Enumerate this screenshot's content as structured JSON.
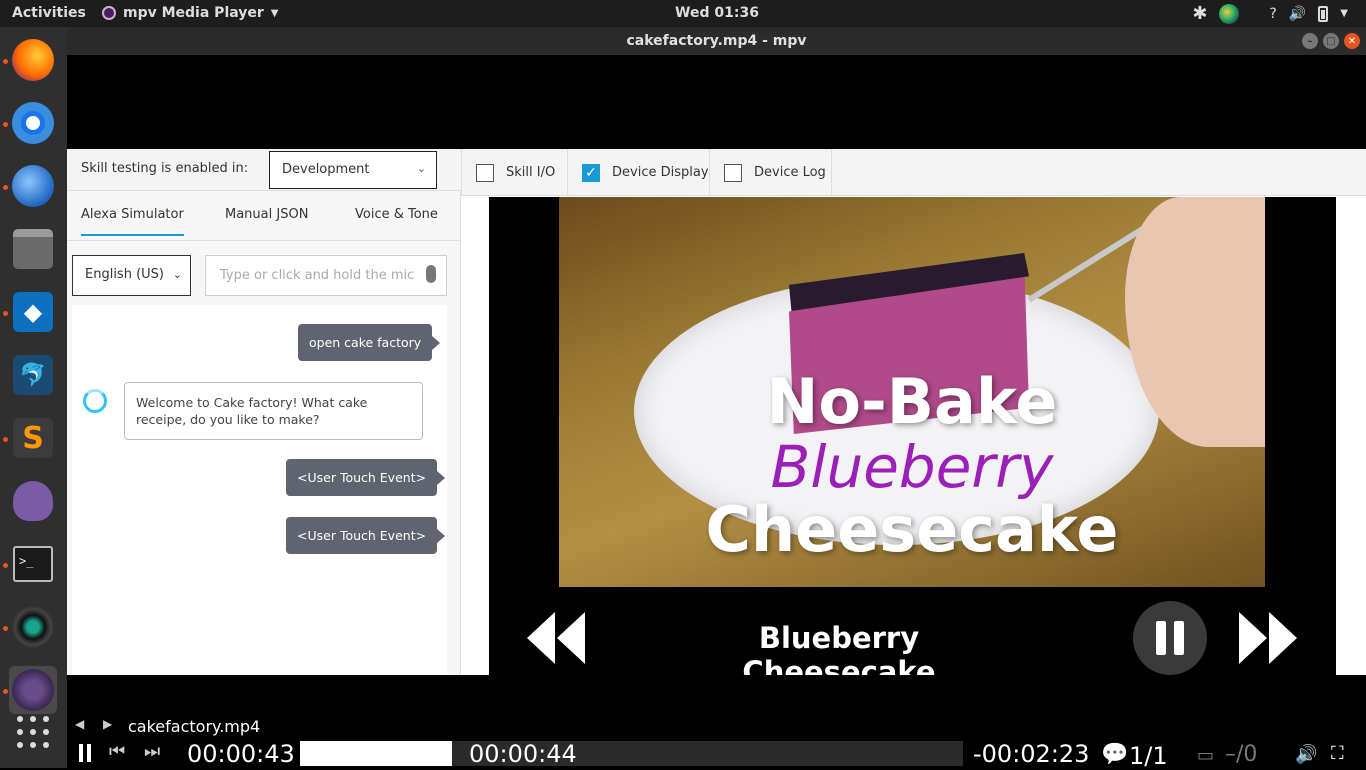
{
  "topbar": {
    "activities": "Activities",
    "app_name": "mpv Media Player",
    "clock": "Wed 01:36",
    "tray_help": "?"
  },
  "dock": {
    "apps": [
      "firefox-icon",
      "chromium-icon",
      "thunderbird-icon",
      "files-icon",
      "vscode-icon",
      "mysql-workbench-icon",
      "sublime-text-icon",
      "pidgin-icon",
      "terminal-icon",
      "camera-icon",
      "mpv-icon"
    ],
    "terminal_glyph": ">_",
    "vscode_glyph": "◆",
    "sublime_glyph": "S",
    "workbench_glyph": "🐬"
  },
  "window": {
    "title": "cakefactory.mp4 - mpv"
  },
  "console": {
    "skill_label": "Skill testing is enabled in:",
    "stage_value": "Development",
    "checkboxes": [
      {
        "label": "Skill I/O",
        "checked": false
      },
      {
        "label": "Device Display",
        "checked": true
      },
      {
        "label": "Device Log",
        "checked": false
      }
    ],
    "tabs": [
      "Alexa Simulator",
      "Manual JSON",
      "Voice & Tone"
    ],
    "language": "English (US)",
    "utterance_placeholder": "Type or click and hold the mic",
    "chat": [
      {
        "from": "user",
        "text": "open cake factory"
      },
      {
        "from": "alexa",
        "text": "Welcome to Cake factory! What cake receipe, do you like to make?"
      },
      {
        "from": "user",
        "text": "<User Touch Event>"
      },
      {
        "from": "user",
        "text": "<User Touch Event>"
      }
    ]
  },
  "device": {
    "overlay_line1": "No-Bake",
    "overlay_line2": "Blueberry",
    "overlay_line3": "Cheesecake",
    "title": "Blueberry Cheesecake"
  },
  "osc": {
    "filename": "cakefactory.mp4",
    "time_elapsed": "00:00:43",
    "time_cursor": "00:00:44",
    "time_remaining": "-00:02:23",
    "chapters": "1/1",
    "subtitles": "–/0",
    "progress_fraction": 0.23
  },
  "colors": {
    "accent": "#1a9ad6",
    "ubuntu_orange": "#e95420",
    "overlay_purple": "#9b1fb8"
  }
}
